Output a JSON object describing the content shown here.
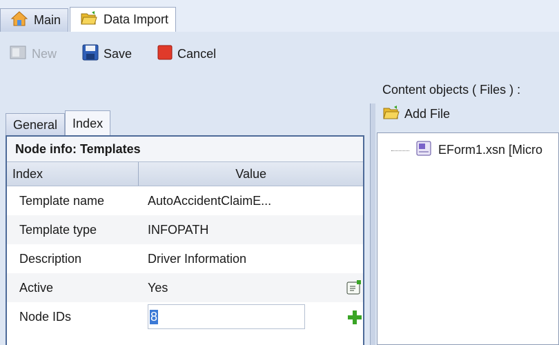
{
  "tabs": [
    {
      "label": "Main",
      "icon": "home-icon"
    },
    {
      "label": "Data Import",
      "icon": "folder-open-icon"
    }
  ],
  "toolbar": {
    "new_label": "New",
    "save_label": "Save",
    "cancel_label": "Cancel"
  },
  "subtabs": [
    {
      "label": "General"
    },
    {
      "label": "Index"
    }
  ],
  "grid": {
    "title": "Node info: Templates",
    "col_index": "Index",
    "col_value": "Value",
    "rows": [
      {
        "index": "Template name",
        "value": "AutoAccidentClaimE..."
      },
      {
        "index": "Template type",
        "value": "INFOPATH"
      },
      {
        "index": "Description",
        "value": "Driver Information"
      },
      {
        "index": "Active",
        "value": "Yes",
        "icon": "edit-form-icon"
      },
      {
        "index": "Node IDs",
        "value": "8",
        "icon": "add-plus-icon"
      }
    ]
  },
  "content": {
    "label": "Content objects ( Files ) :",
    "add_file_label": "Add File",
    "files": [
      {
        "name": "EForm1.xsn [Micro",
        "icon": "infopath-file-icon"
      }
    ]
  },
  "colors": {
    "accent": "#3c7ad6",
    "border": "#4d6a98",
    "cancel_red": "#e03a2a",
    "plus_green": "#3aa526"
  }
}
